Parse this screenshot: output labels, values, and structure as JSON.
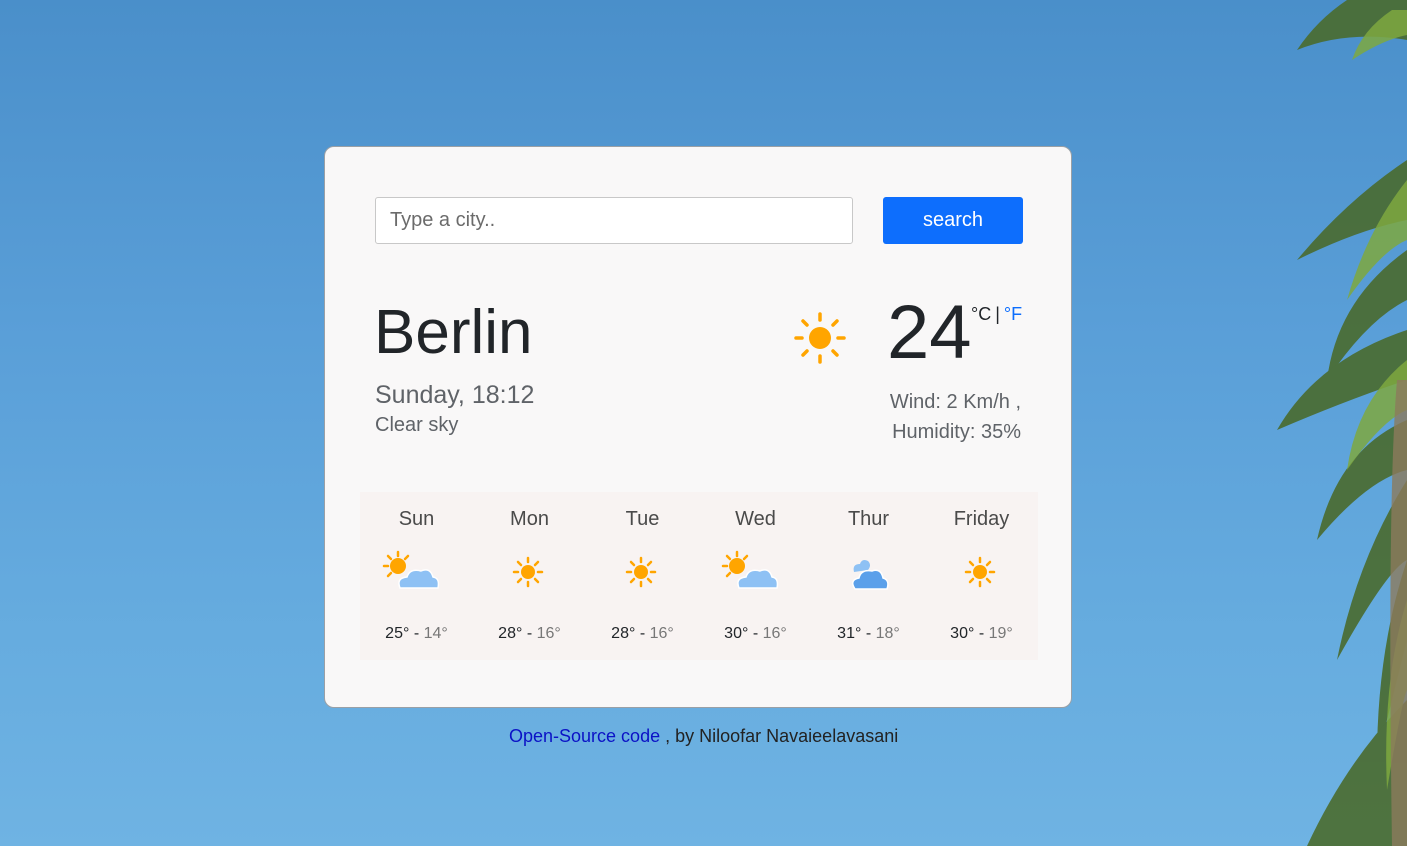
{
  "search": {
    "placeholder": "Type a city..",
    "value": "",
    "button_label": "search"
  },
  "current": {
    "city": "Berlin",
    "datetime": "Sunday, 18:12",
    "description": "Clear sky",
    "icon": "sun-icon",
    "temperature": "24",
    "unit_celsius": "°C",
    "unit_separator": "|",
    "unit_fahrenheit": "°F",
    "wind": "Wind: 2 Km/h ,",
    "humidity": "Humidity: 35%"
  },
  "forecast": [
    {
      "day": "Sun",
      "icon": "sun-behind-cloud-icon",
      "max": "25°",
      "sep": "-",
      "min": "14°"
    },
    {
      "day": "Mon",
      "icon": "sun-icon",
      "max": "28°",
      "sep": "-",
      "min": "16°"
    },
    {
      "day": "Tue",
      "icon": "sun-icon",
      "max": "28°",
      "sep": "-",
      "min": "16°"
    },
    {
      "day": "Wed",
      "icon": "sun-behind-cloud-icon",
      "max": "30°",
      "sep": "-",
      "min": "16°"
    },
    {
      "day": "Thur",
      "icon": "cloud-icon",
      "max": "31°",
      "sep": "-",
      "min": "18°"
    },
    {
      "day": "Friday",
      "icon": "sun-icon",
      "max": "30°",
      "sep": "-",
      "min": "19°"
    }
  ],
  "footer": {
    "link_text": "Open-Source code",
    "author_text": ", by Niloofar Navaieelavasani"
  },
  "colors": {
    "accent": "#0d6efd",
    "sun": "#ffa500",
    "cloud": "#8ec1f4",
    "cloud_dark": "#5ba0ea"
  }
}
